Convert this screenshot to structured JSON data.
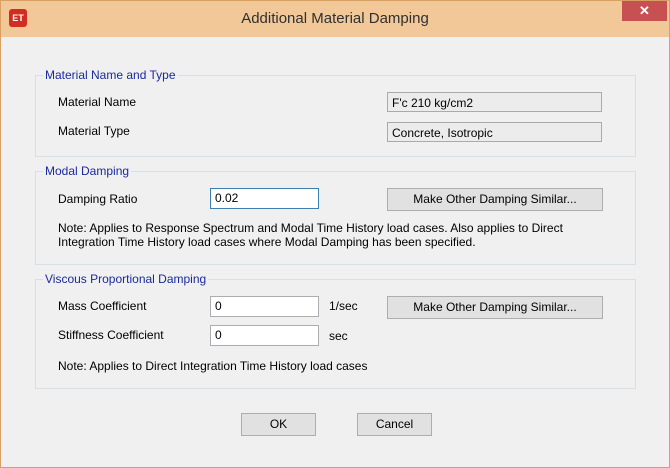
{
  "window": {
    "title": "Additional Material Damping",
    "app_icon_text": "ET",
    "close_glyph": "✕"
  },
  "material_group": {
    "title": "Material Name and Type",
    "name_label": "Material Name",
    "name_value": "F'c 210 kg/cm2",
    "type_label": "Material Type",
    "type_value": "Concrete, Isotropic"
  },
  "modal_group": {
    "title": "Modal Damping",
    "ratio_label": "Damping Ratio",
    "ratio_value": "0.02",
    "similar_button": "Make Other Damping Similar...",
    "note_line1": "Note:  Applies to Response Spectrum and Modal Time History load cases.  Also applies to Direct",
    "note_line2": "Integration Time History load cases where Modal Damping has been specified."
  },
  "viscous_group": {
    "title": "Viscous Proportional Damping",
    "mass_label": "Mass Coefficient",
    "mass_value": "0",
    "mass_unit": "1/sec",
    "stiffness_label": "Stiffness Coefficient",
    "stiffness_value": "0",
    "stiffness_unit": "sec",
    "similar_button": "Make Other Damping Similar...",
    "note": "Note:  Applies to Direct Integration Time History load cases"
  },
  "buttons": {
    "ok": "OK",
    "cancel": "Cancel"
  }
}
